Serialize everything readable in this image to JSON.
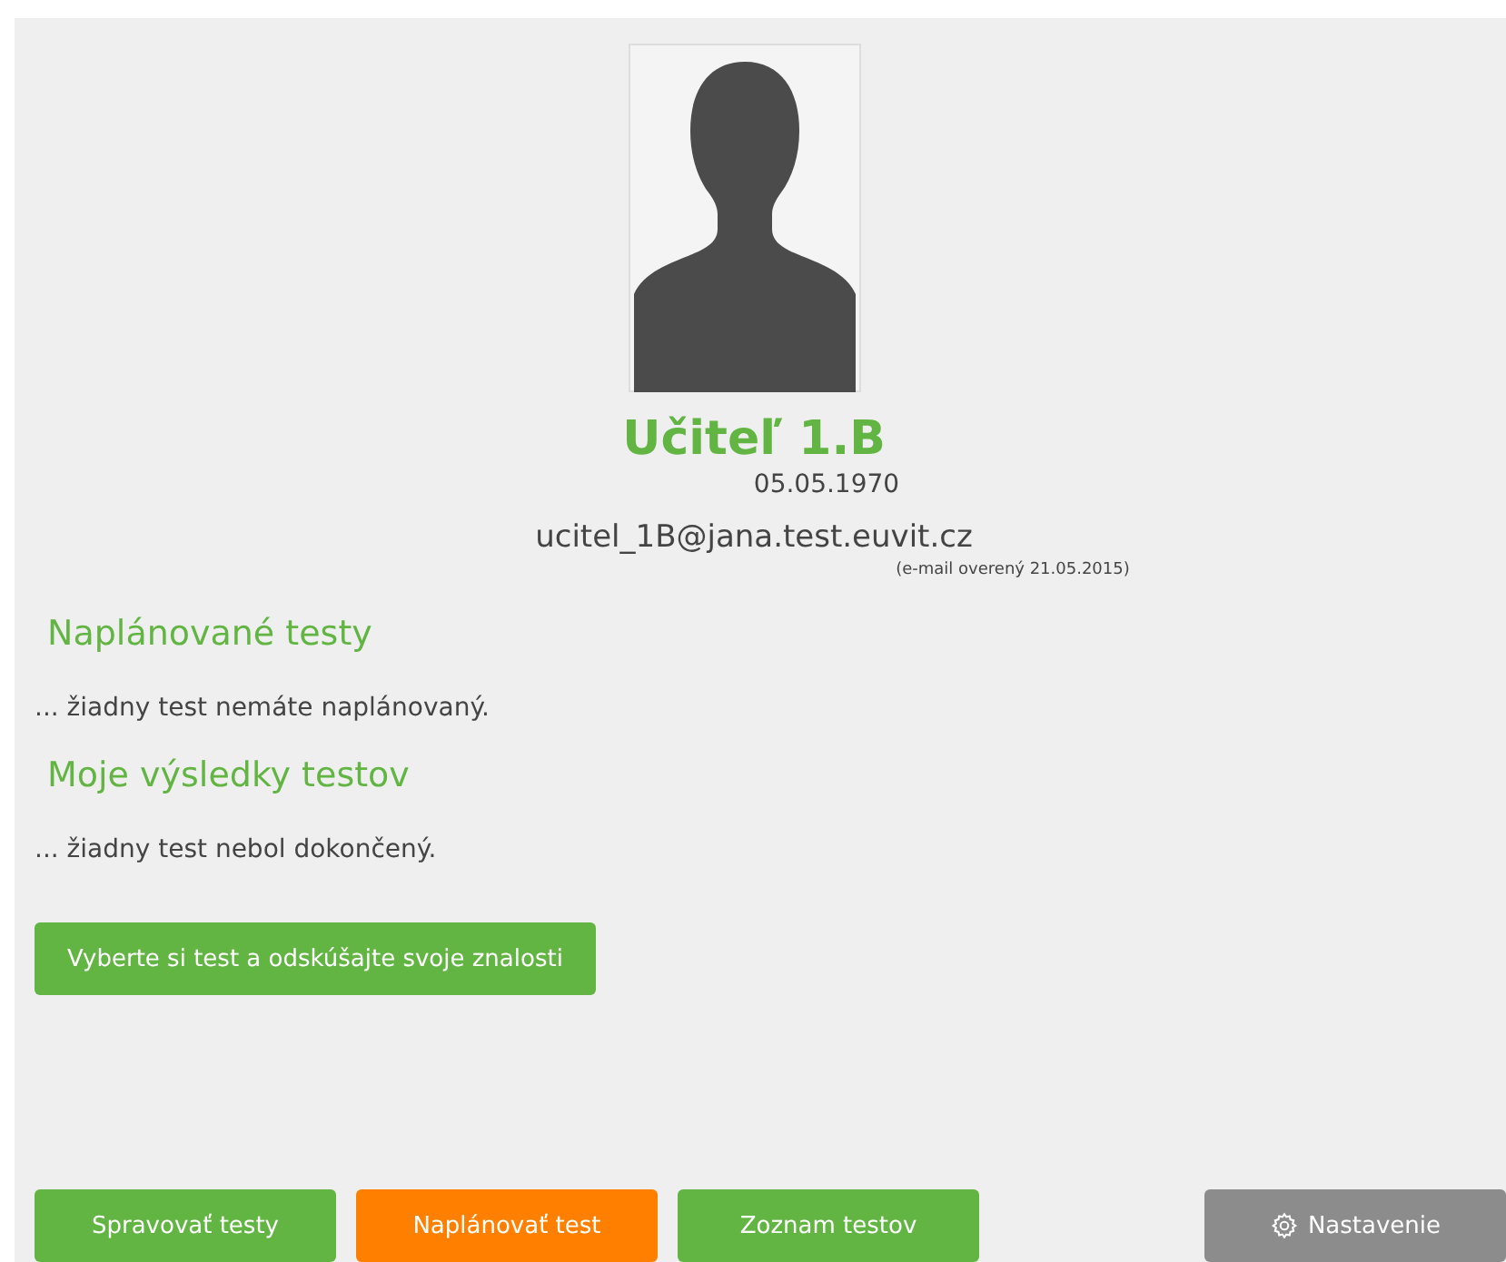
{
  "profile": {
    "name": "Učiteľ 1.B",
    "birth_date": "05.05.1970",
    "email": "ucitel_1B@jana.test.euvit.cz",
    "email_note": "(e-mail overený 21.05.2015)"
  },
  "sections": [
    {
      "title": "Naplánované testy",
      "text": "... žiadny test nemáte naplánovaný."
    },
    {
      "title": "Moje výsledky testov",
      "text": "... žiadny test nebol dokončený."
    }
  ],
  "main_button": {
    "label": "Vyberte si test a odskúšajte svoje znalosti",
    "kind": "primary"
  },
  "bottom_buttons": [
    {
      "label": "Spravovať testy",
      "kind": "primary"
    },
    {
      "label": "Naplánovať test",
      "kind": "warning"
    },
    {
      "label": "Zoznam testov",
      "kind": "primary"
    },
    {
      "label": "Nastavenie",
      "kind": "settings"
    }
  ]
}
